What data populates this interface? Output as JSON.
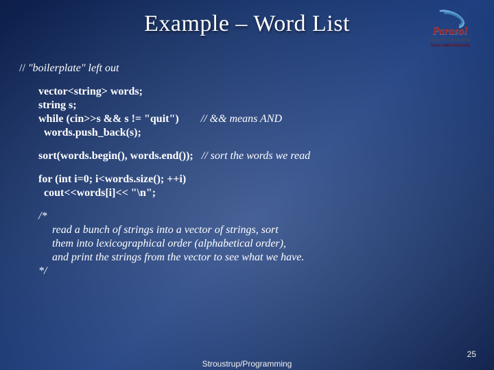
{
  "title": "Example – Word List",
  "logo": {
    "brand": "Parasol",
    "tagline": "Smarter computing.",
    "university": "Texas A&M University"
  },
  "code": {
    "c0": "// ",
    "c0i": "\"boilerplate\" left out",
    "l1": "vector<string> words;",
    "l2": "string s;",
    "l3a": "while (cin>>s && s != \"quit\")",
    "l3pad": "        ",
    "l3b": "// ",
    "l3c": "&& means AND",
    "l4": "  words.push_back(s);",
    "l5a": "sort(words.begin(), words.end());",
    "l5pad": "   ",
    "l5b": "// ",
    "l5c": "sort the words we read",
    "l6": "for (int i=0; i<words.size(); ++i)",
    "l7": "  cout<<words[i]<< \"\\n\";",
    "c8": "/* ",
    "c9": "     read a bunch of strings into a vector of strings, sort",
    "c10": "     them into lexicographical order (alphabetical order),",
    "c11": "     and print the strings from the vector to see what we have.",
    "c12": "*/"
  },
  "footer": {
    "center": "Stroustrup/Programming",
    "page": "25"
  }
}
